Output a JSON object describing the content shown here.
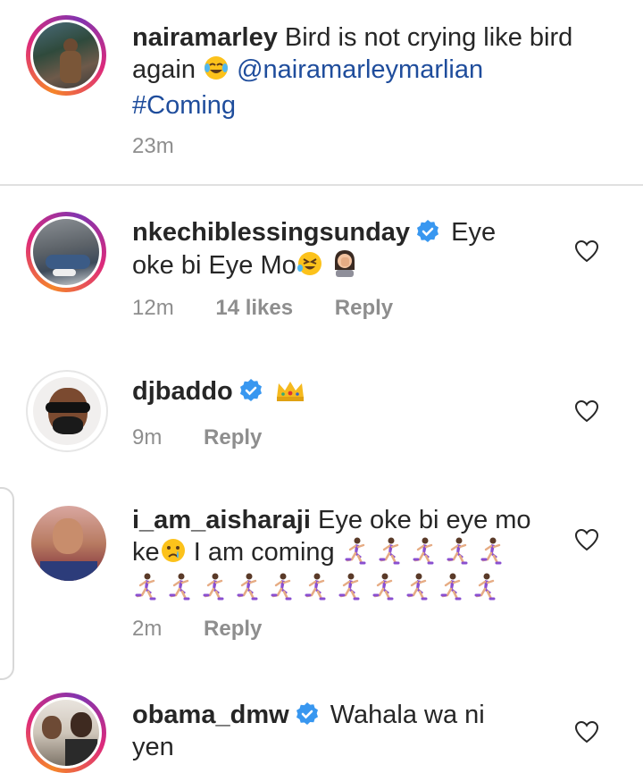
{
  "caption": {
    "username": "nairamarley",
    "text_part1": "Bird is not crying like bird again",
    "mention": "@nairamarleymarlian",
    "hashtag": "#Coming",
    "time": "23m",
    "emoji": "tears-of-joy-emoji"
  },
  "comments": [
    {
      "username": "nkechiblessingsunday",
      "verified": true,
      "text_line1": "Eye",
      "text_line2": "oke bi Eye Mo",
      "time": "12m",
      "likes": "14 likes",
      "reply": "Reply",
      "emojis": [
        "rolling-on-floor-laughing-emoji",
        "woman-facepalming-emoji"
      ]
    },
    {
      "username": "djbaddo",
      "verified": true,
      "text": "",
      "time": "9m",
      "reply": "Reply",
      "emojis": [
        "crown-emoji"
      ]
    },
    {
      "username": "i_am_aisharaji",
      "verified": false,
      "text_line1": "Eye oke bi eye mo",
      "text_ke": "ke",
      "text_after": "I am coming",
      "time": "2m",
      "reply": "Reply",
      "emojis": [
        "crying-face-emoji",
        "woman-running-emoji"
      ]
    },
    {
      "username": "obama_dmw",
      "verified": true,
      "text_line1": "Wahala wa ni",
      "text_line2": "yen",
      "emojis": []
    }
  ],
  "colors": {
    "mention": "#1f4d9c",
    "verified": "#3897f0",
    "meta": "#8e8e8e",
    "text": "#262626"
  }
}
